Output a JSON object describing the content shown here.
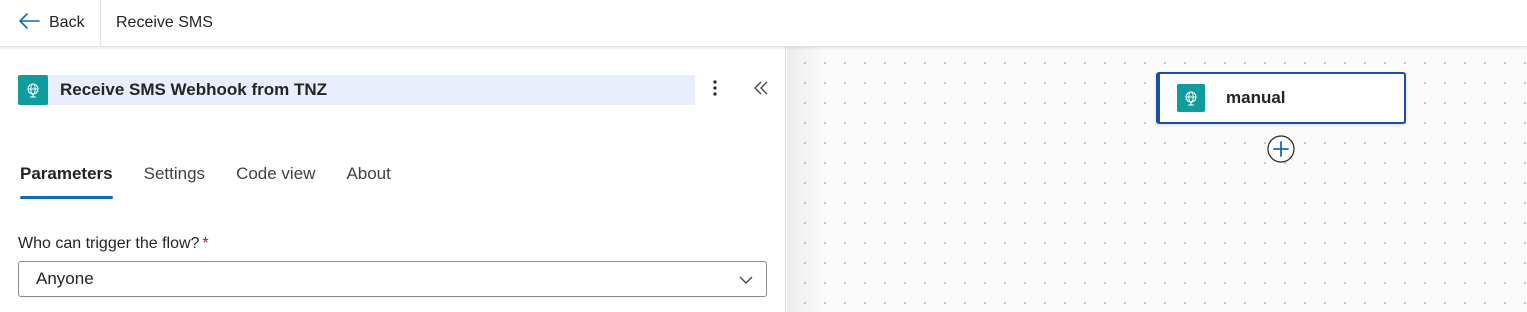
{
  "topbar": {
    "back_label": "Back",
    "title": "Receive SMS"
  },
  "panel": {
    "title": "Receive SMS Webhook from TNZ",
    "tabs": [
      {
        "label": "Parameters",
        "active": true
      },
      {
        "label": "Settings",
        "active": false
      },
      {
        "label": "Code view",
        "active": false
      },
      {
        "label": "About",
        "active": false
      }
    ],
    "field": {
      "label": "Who can trigger the flow?",
      "required_mark": "*",
      "value": "Anyone"
    }
  },
  "canvas": {
    "node_label": "manual"
  },
  "colors": {
    "accent": "#0f6cbd",
    "connector": "#0f9c9c",
    "node_border": "#1f4fa0",
    "required": "#c50f1f"
  },
  "icons": [
    "arrow-left-icon",
    "globe-connector-icon",
    "more-vertical-icon",
    "double-chevron-left-icon",
    "chevron-down-icon",
    "add-circle-icon"
  ]
}
